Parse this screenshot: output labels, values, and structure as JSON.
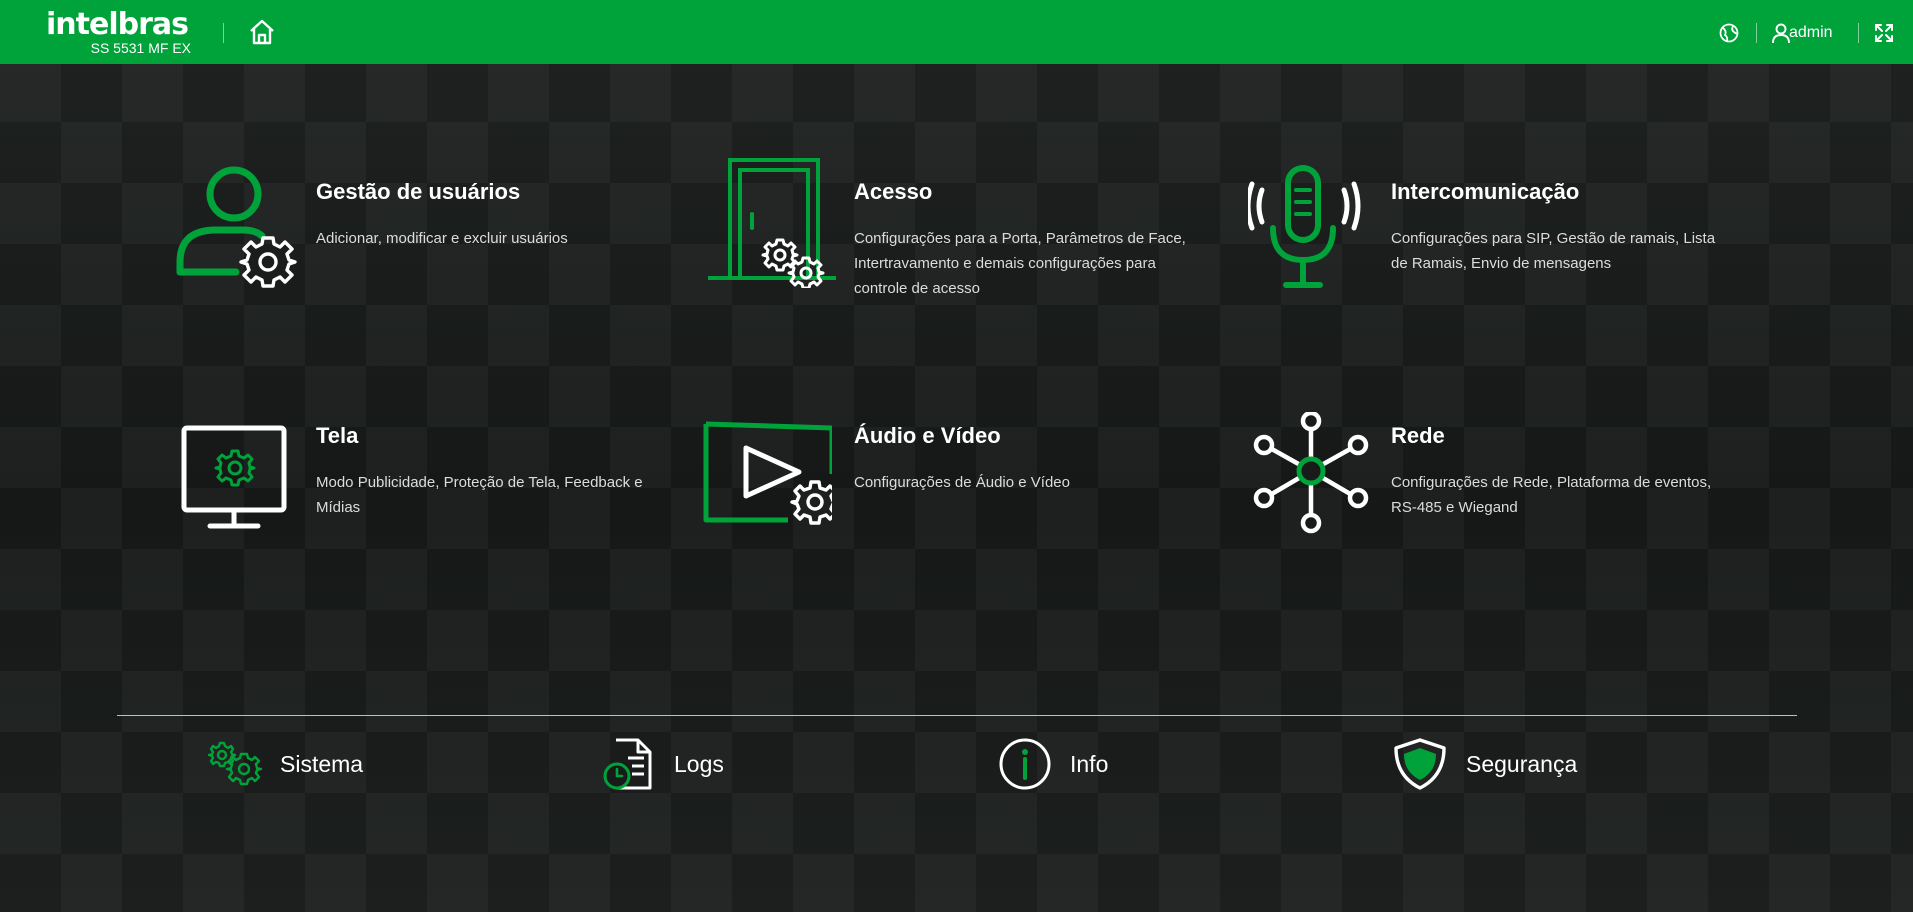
{
  "header": {
    "brand": "intelbras",
    "model": "SS 5531 MF EX",
    "user": "admin",
    "colors": {
      "brand_green": "#00a23a"
    },
    "icons": [
      "home-icon",
      "language-icon",
      "user-icon",
      "fullscreen-icon"
    ]
  },
  "cards": [
    {
      "title": "Gestão de usuários",
      "description": "Adicionar, modificar e excluir usuários",
      "icon": "user-settings-icon"
    },
    {
      "title": "Acesso",
      "description": "Configurações para a Porta, Parâmetros de Face, Intertravamento e demais configurações para controle de acesso",
      "icon": "door-settings-icon"
    },
    {
      "title": "Intercomunicação",
      "description": "Configurações para SIP, Gestão de ramais, Lista de Ramais, Envio de mensagens",
      "icon": "microphone-icon"
    },
    {
      "title": "Tela",
      "description": "Modo Publicidade, Proteção de Tela, Feedback e Mídias",
      "icon": "monitor-settings-icon"
    },
    {
      "title": "Áudio e Vídeo",
      "description": "Configurações de Áudio e Vídeo",
      "icon": "video-settings-icon"
    },
    {
      "title": "Rede",
      "description": "Configurações de Rede, Plataforma de eventos, RS-485 e Wiegand",
      "icon": "network-icon"
    }
  ],
  "bottom_nav": [
    {
      "label": "Sistema",
      "icon": "gears-icon"
    },
    {
      "label": "Logs",
      "icon": "log-document-icon"
    },
    {
      "label": "Info",
      "icon": "info-icon"
    },
    {
      "label": "Segurança",
      "icon": "shield-icon"
    }
  ]
}
